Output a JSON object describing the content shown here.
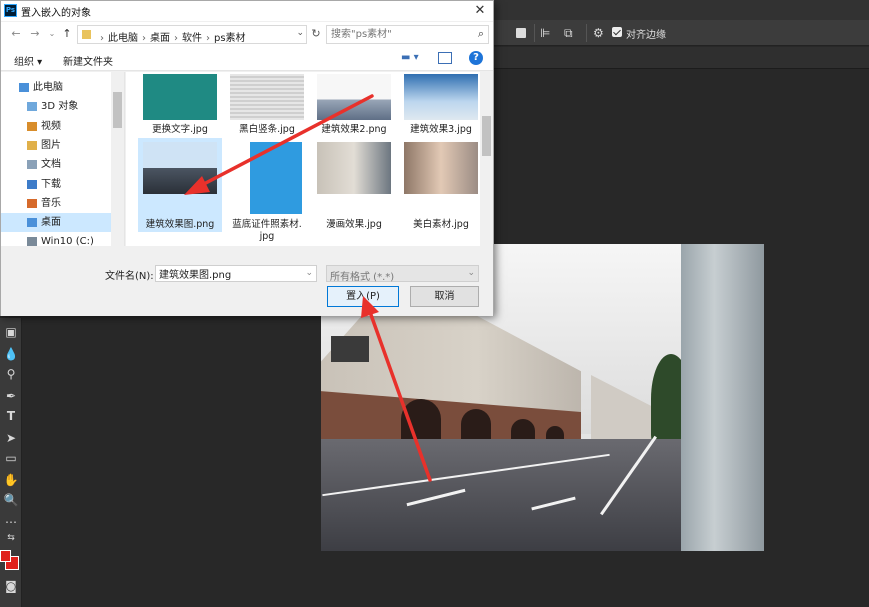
{
  "dialog": {
    "title": "置入嵌入的对象",
    "ps_logo": "Ps",
    "close_glyph": "✕"
  },
  "address": {
    "crumbs": [
      "此电脑",
      "桌面",
      "软件",
      "ps素材"
    ],
    "search_placeholder": "搜索\"ps素材\""
  },
  "toolbar": {
    "organize": "组织 ▾",
    "new_folder": "新建文件夹",
    "help": "?"
  },
  "nav": {
    "items": [
      {
        "label": "此电脑",
        "icon": "computer-icon",
        "indent": 1
      },
      {
        "label": "3D 对象",
        "icon": "cube-icon",
        "indent": 2
      },
      {
        "label": "视频",
        "icon": "video-icon",
        "indent": 2
      },
      {
        "label": "图片",
        "icon": "pictures-icon",
        "indent": 2
      },
      {
        "label": "文档",
        "icon": "documents-icon",
        "indent": 2
      },
      {
        "label": "下载",
        "icon": "download-icon",
        "indent": 2
      },
      {
        "label": "音乐",
        "icon": "music-icon",
        "indent": 2
      },
      {
        "label": "桌面",
        "icon": "desktop-icon",
        "indent": 2,
        "selected": true
      },
      {
        "label": "Win10 (C:)",
        "icon": "drive-icon",
        "indent": 2
      }
    ]
  },
  "files": [
    {
      "name": "更换文字.jpg",
      "lines": [
        "更换文字.jpg"
      ]
    },
    {
      "name": "黑白竖条.jpg",
      "lines": [
        "黑白竖条.jpg"
      ]
    },
    {
      "name": "建筑效果2.png",
      "lines": [
        "建筑效果2.png"
      ]
    },
    {
      "name": "建筑效果3.jpg",
      "lines": [
        "建筑效果3.jpg"
      ]
    },
    {
      "name": "建筑效果图.png",
      "lines": [
        "建筑效果图.png"
      ],
      "selected": true
    },
    {
      "name": "蓝底证件照素材.jpg",
      "lines": [
        "蓝底证件照素材.",
        "jpg"
      ]
    },
    {
      "name": "漫画效果.jpg",
      "lines": [
        "漫画效果.jpg"
      ]
    },
    {
      "name": "美白素材.jpg",
      "lines": [
        "美白素材.jpg"
      ]
    }
  ],
  "bottom": {
    "filename_label": "文件名(N):",
    "filename_value": "建筑效果图.png",
    "type_value": "所有格式 (*.*)",
    "place_label": "置入(P)",
    "cancel_label": "取消"
  },
  "ps": {
    "align_edges_label": "对齐边缘"
  },
  "colors": {
    "foreground": "#e0201b",
    "accent": "#0078d7",
    "arrow": "#e8312b"
  }
}
